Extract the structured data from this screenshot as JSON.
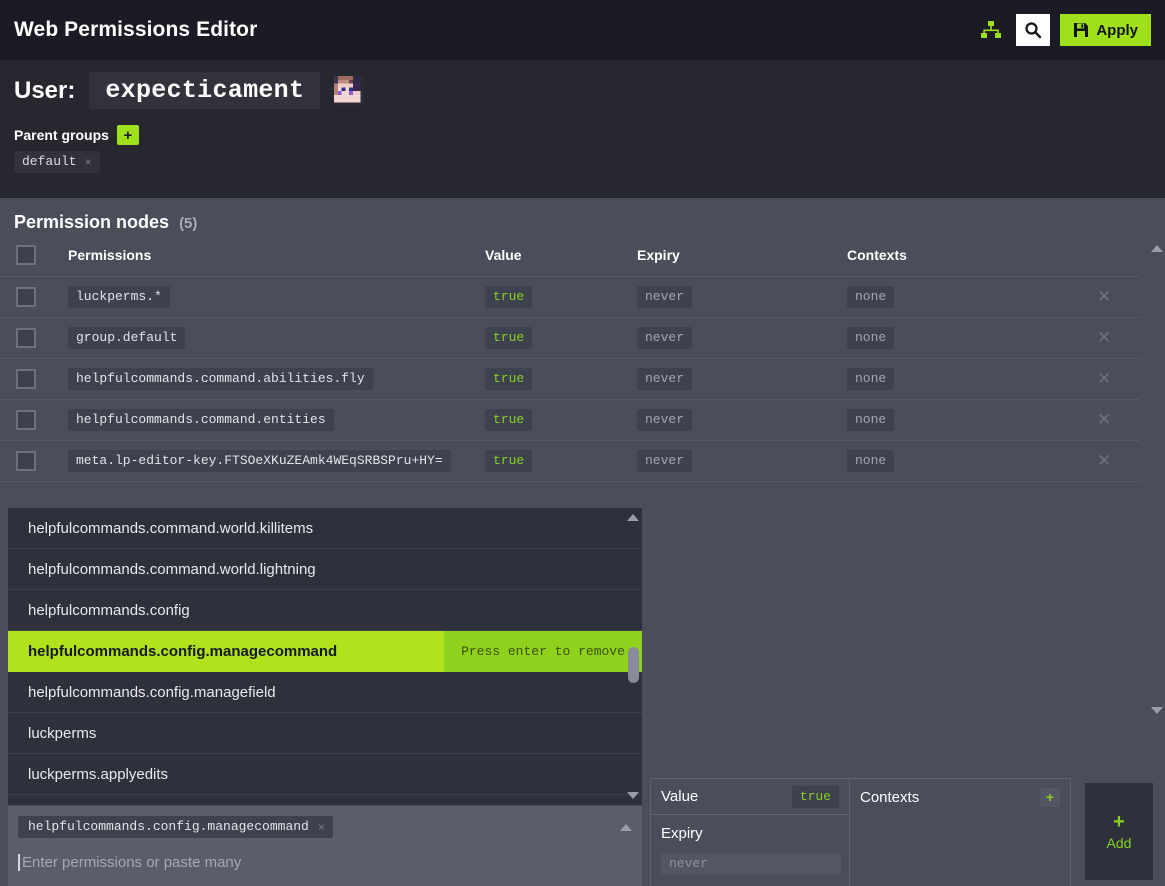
{
  "header": {
    "title": "Web Permissions Editor",
    "tree_icon": "sitemap-icon",
    "search_icon": "search-icon",
    "apply_label": "Apply",
    "apply_icon": "save-icon",
    "accent_green": "#a0e01a",
    "bar_background": "#1b1b25"
  },
  "user": {
    "label": "User:",
    "name": "expecticament",
    "avatar_alt": "player-avatar",
    "parent_groups_label": "Parent groups",
    "add_group_label": "+",
    "groups": [
      {
        "name": "default",
        "remove": "×"
      }
    ]
  },
  "nodes": {
    "title": "Permission nodes",
    "count": "(5)",
    "columns": {
      "permissions": "Permissions",
      "value": "Value",
      "expiry": "Expiry",
      "contexts": "Contexts"
    },
    "rows": [
      {
        "permission": "luckperms.*",
        "value": "true",
        "expiry": "never",
        "contexts": "none",
        "remove": "✕"
      },
      {
        "permission": "group.default",
        "value": "true",
        "expiry": "never",
        "contexts": "none",
        "remove": "✕"
      },
      {
        "permission": "helpfulcommands.command.abilities.fly",
        "value": "true",
        "expiry": "never",
        "contexts": "none",
        "remove": "✕"
      },
      {
        "permission": "helpfulcommands.command.entities",
        "value": "true",
        "expiry": "never",
        "contexts": "none",
        "remove": "✕"
      },
      {
        "permission": "meta.lp-editor-key.FTSOeXKuZEAmk4WEqSRBSPru+HY=",
        "value": "true",
        "expiry": "never",
        "contexts": "none",
        "remove": "✕"
      }
    ],
    "value_true_color": "#86d122"
  },
  "dropdown": {
    "items": [
      {
        "label": "helpfulcommands.command.world.killitems",
        "selected": false
      },
      {
        "label": "helpfulcommands.command.world.lightning",
        "selected": false
      },
      {
        "label": "helpfulcommands.config",
        "selected": false
      },
      {
        "label": "helpfulcommands.config.managecommand",
        "selected": true,
        "hint": "Press enter to remove"
      },
      {
        "label": "helpfulcommands.config.managefield",
        "selected": false
      },
      {
        "label": "luckperms",
        "selected": false
      },
      {
        "label": "luckperms.applyedits",
        "selected": false
      }
    ],
    "highlight_color": "#b0e31c",
    "hint_color": "#8fd11c"
  },
  "input": {
    "chips": [
      {
        "label": "helpfulcommands.config.managecommand",
        "remove": "×"
      }
    ],
    "placeholder": "Enter permissions or paste many",
    "value": ""
  },
  "editor_panel": {
    "value_label": "Value",
    "value_current": "true",
    "expiry_label": "Expiry",
    "expiry_placeholder": "never",
    "expiry_value": "",
    "contexts_label": "Contexts",
    "contexts_add": "+",
    "add_plus": "+",
    "add_label": "Add"
  }
}
